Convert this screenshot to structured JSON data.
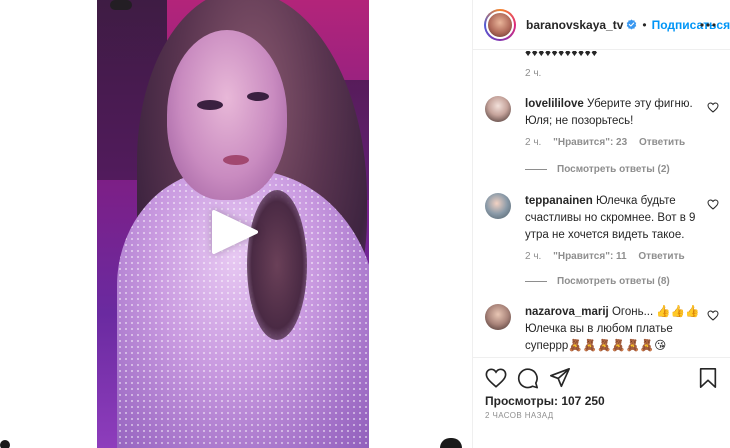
{
  "post": {
    "username": "baranovskaya_tv",
    "separator": "•",
    "follow_label": "Подписаться",
    "views_label": "Просмотры: 107 250",
    "posted_ago": "2 ЧАСОВ НАЗАД"
  },
  "comments": {
    "truncated_line": "♦♦♦♦♦♦♦♦♦♦♦",
    "first_time": "2 ч.",
    "items": [
      {
        "user": "lovelililove",
        "text": "Уберите эту фигню. Юля; не позорьтесь!",
        "time": "2 ч.",
        "likes": "\"Нравится\": 23",
        "reply": "Ответить",
        "replies": "Посмотреть ответы (2)"
      },
      {
        "user": "teppanainen",
        "text": "Юлечка будьте счастливы но скромнее. Вот в 9 утра не хочется видеть такое.",
        "time": "2 ч.",
        "likes": "\"Нравится\": 11",
        "reply": "Ответить",
        "replies": "Посмотреть ответы (8)"
      },
      {
        "user": "nazarova_marij",
        "text": "Огонь... 👍👍👍 Юлечка вы в любом платье суперрр🧸🧸🧸🧸🧸🧸😘"
      }
    ]
  },
  "icons": {
    "play": "play-icon",
    "more": "more-icon",
    "verified": "verified-badge-icon",
    "heart": "heart-icon",
    "comment": "comment-icon",
    "share": "share-icon",
    "save": "bookmark-icon"
  },
  "colors": {
    "accent": "#0095f6",
    "text": "#262626",
    "muted": "#8e8e8e"
  }
}
